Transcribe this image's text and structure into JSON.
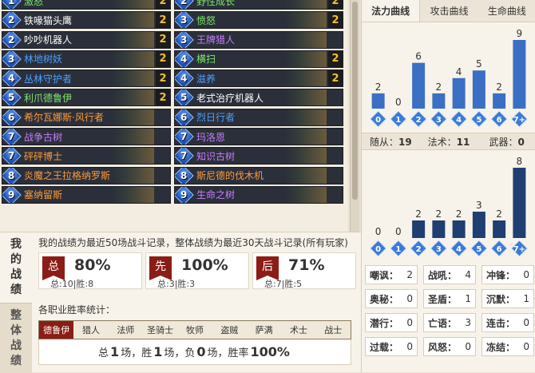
{
  "deck": {
    "left": [
      {
        "cost": "1",
        "name": "激怒",
        "rarity": "c-free",
        "count": "2",
        "clipped": true
      },
      {
        "cost": "2",
        "name": "铁喙猫头鹰",
        "rarity": "c-common",
        "count": "2"
      },
      {
        "cost": "2",
        "name": "吵吵机器人",
        "rarity": "c-common",
        "count": "2"
      },
      {
        "cost": "3",
        "name": "林地树妖",
        "rarity": "c-rare",
        "count": "2"
      },
      {
        "cost": "4",
        "name": "丛林守护者",
        "rarity": "c-rare",
        "count": "2"
      },
      {
        "cost": "5",
        "name": "利爪德鲁伊",
        "rarity": "c-free",
        "count": "2"
      },
      {
        "cost": "6",
        "name": "希尔瓦娜斯·风行者",
        "rarity": "c-legend",
        "count": ""
      },
      {
        "cost": "7",
        "name": "战争古树",
        "rarity": "c-epic",
        "count": ""
      },
      {
        "cost": "7",
        "name": "砰砰博士",
        "rarity": "c-legend",
        "count": ""
      },
      {
        "cost": "8",
        "name": "炎魔之王拉格纳罗斯",
        "rarity": "c-legend",
        "count": ""
      },
      {
        "cost": "9",
        "name": "塞纳留斯",
        "rarity": "c-legend",
        "count": ""
      }
    ],
    "right": [
      {
        "cost": "2",
        "name": "野性成长",
        "rarity": "c-free",
        "count": "2",
        "clipped": true
      },
      {
        "cost": "3",
        "name": "愤怒",
        "rarity": "c-free",
        "count": "2"
      },
      {
        "cost": "3",
        "name": "王牌猎人",
        "rarity": "c-epic",
        "count": ""
      },
      {
        "cost": "4",
        "name": "横扫",
        "rarity": "c-free",
        "count": "2"
      },
      {
        "cost": "4",
        "name": "滋养",
        "rarity": "c-rare",
        "count": "2"
      },
      {
        "cost": "5",
        "name": "老式治疗机器人",
        "rarity": "c-common",
        "count": ""
      },
      {
        "cost": "6",
        "name": "烈日行者",
        "rarity": "c-rare",
        "count": ""
      },
      {
        "cost": "7",
        "name": "玛洛恩",
        "rarity": "c-epic",
        "count": ""
      },
      {
        "cost": "7",
        "name": "知识古树",
        "rarity": "c-epic",
        "count": ""
      },
      {
        "cost": "8",
        "name": "斯尼德的伐木机",
        "rarity": "c-legend",
        "count": ""
      },
      {
        "cost": "9",
        "name": "生命之树",
        "rarity": "c-epic",
        "count": ""
      }
    ]
  },
  "stats": {
    "side_tabs": [
      "我的战绩",
      "整体战绩"
    ],
    "title": "我的战绩为最近50场战斗记录，整体战绩为最近30天战斗记录(所有玩家)",
    "boxes": [
      {
        "tag": "总",
        "pct": "80%",
        "sub": "总:10|胜:8"
      },
      {
        "tag": "先",
        "pct": "100%",
        "sub": "总:3|胜:3"
      },
      {
        "tag": "后",
        "pct": "71%",
        "sub": "总:7|胜:5"
      }
    ],
    "class_label": "各职业胜率统计：",
    "classes": [
      "德鲁伊",
      "猎人",
      "法师",
      "圣骑士",
      "牧师",
      "盗贼",
      "萨满",
      "术士",
      "战士"
    ],
    "result": {
      "p1": "总",
      "total": "1",
      "p2": "场，胜",
      "win": "1",
      "p3": "场，负",
      "lose": "0",
      "p4": "场，胜率",
      "rate": "100%"
    }
  },
  "curve_tabs": [
    "法力曲线",
    "攻击曲线",
    "生命曲线"
  ],
  "chart_data": [
    {
      "type": "bar",
      "title": "法力曲线",
      "categories": [
        "0",
        "1",
        "2",
        "3",
        "4",
        "5",
        "6",
        "7+"
      ],
      "values": [
        2,
        0,
        6,
        2,
        4,
        5,
        2,
        9
      ],
      "color": "#3b6fc4"
    },
    {
      "type": "bar",
      "title": "",
      "categories": [
        "0",
        "1",
        "2",
        "3",
        "4",
        "5",
        "6",
        "7+"
      ],
      "values": [
        0,
        0,
        2,
        2,
        2,
        3,
        2,
        8
      ],
      "color": "#1f3f73"
    }
  ],
  "type_counts": [
    {
      "label": "随从：",
      "value": "19"
    },
    {
      "label": "法术：",
      "value": "11"
    },
    {
      "label": "武器：",
      "value": "0"
    }
  ],
  "mechanics": [
    [
      {
        "label": "嘲讽：",
        "value": "2"
      },
      {
        "label": "战吼：",
        "value": "4"
      },
      {
        "label": "冲锋：",
        "value": "0"
      }
    ],
    [
      {
        "label": "奥秘：",
        "value": "0"
      },
      {
        "label": "圣盾：",
        "value": "1"
      },
      {
        "label": "沉默：",
        "value": "1"
      }
    ],
    [
      {
        "label": "潜行：",
        "value": "0"
      },
      {
        "label": "亡语：",
        "value": "3"
      },
      {
        "label": "连击：",
        "value": "0"
      }
    ],
    [
      {
        "label": "过载：",
        "value": "0"
      },
      {
        "label": "风怒：",
        "value": "0"
      },
      {
        "label": "冻结：",
        "value": "0"
      }
    ]
  ]
}
